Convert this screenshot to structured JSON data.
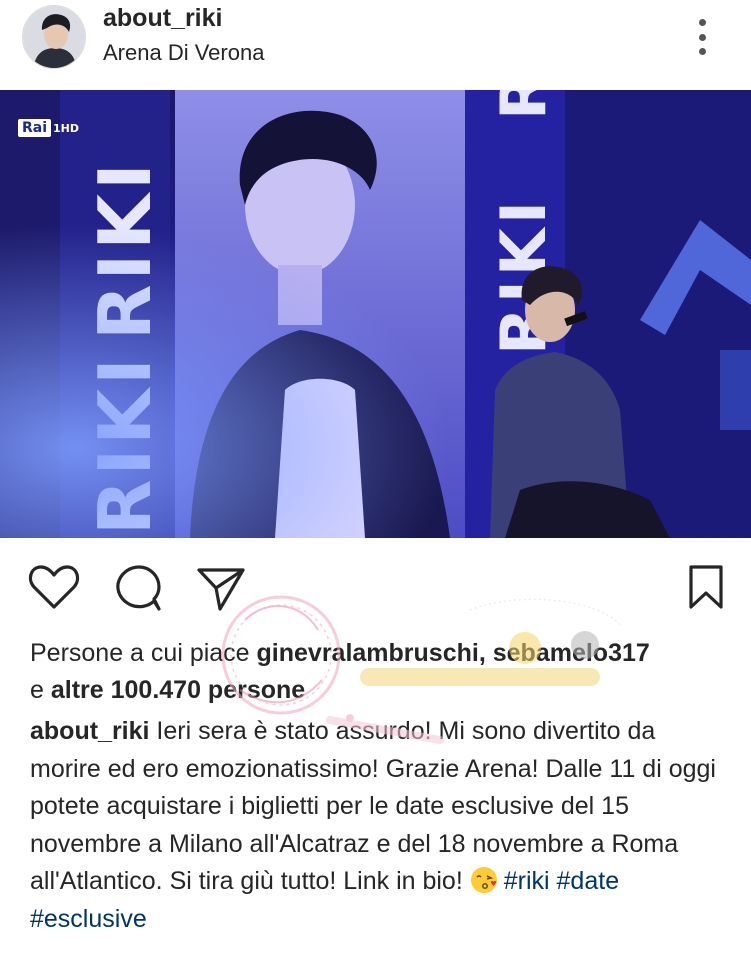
{
  "header": {
    "username": "about_riki",
    "location": "Arena Di Verona"
  },
  "photo": {
    "broadcaster_logo": "Rai",
    "broadcaster_channel": "1HD",
    "screen_text_left": "RIKI",
    "screen_text_right": "RIKI"
  },
  "icons": {
    "like": "heart-icon",
    "comment": "comment-icon",
    "share": "paper-plane-icon",
    "save": "bookmark-icon",
    "more": "more-vertical-icon"
  },
  "likes": {
    "prefix": "Persone a cui piace ",
    "user1": "ginevralambruschi",
    "separator": ", ",
    "user2": "sebamelo317",
    "line2_prefix": "e ",
    "others": "altre 100.470 persone"
  },
  "caption": {
    "username": "about_riki",
    "text": " Ieri sera è stato assurdo! Mi sono divertito da morire ed ero emozionatissimo! Grazie Arena! Dalle 11 di oggi potete acquistare i biglietti per le date esclusive del 15 novembre a Milano all'Alcatraz e del 18 novembre a Roma all'Atlantico. Si tira giù tutto! Link in bio! ",
    "emoji": "kissing-face-emoji",
    "hashtags": [
      "#riki",
      "#date",
      "#esclusive"
    ]
  },
  "colors": {
    "text": "#262626",
    "hashtag": "#003569",
    "stage_blue": "#2a2aa8"
  }
}
